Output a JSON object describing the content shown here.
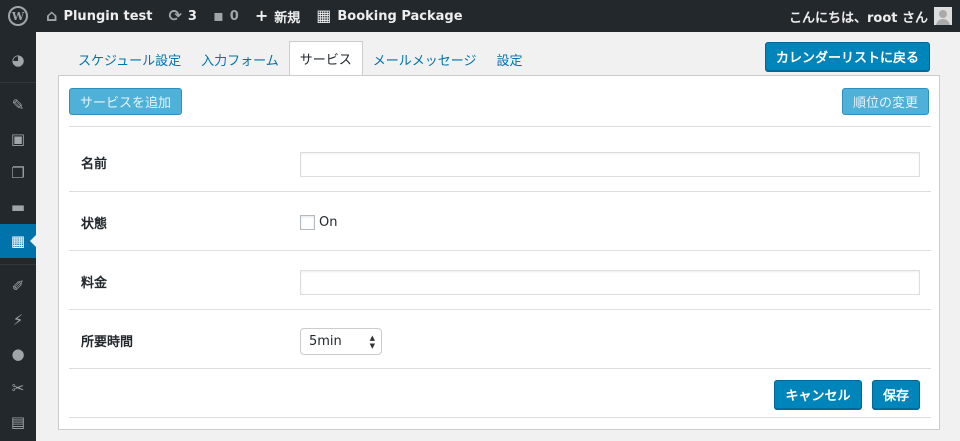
{
  "adminbar": {
    "site_name": "Plungin test",
    "updates_count": "3",
    "comments_count": "0",
    "new_label": "新規",
    "plugin_name": "Booking Package",
    "greeting": "こんにちは、root さん"
  },
  "tabs": [
    "スケジュール設定",
    "入力フォーム",
    "サービス",
    "メールメッセージ",
    "設定"
  ],
  "active_tab": "サービス",
  "buttons": {
    "back_to_calendar": "カレンダーリストに戻る",
    "add_service": "サービスを追加",
    "change_order": "順位の変更",
    "cancel": "キャンセル",
    "save": "保存"
  },
  "form": {
    "name_label": "名前",
    "name_value": "",
    "status_label": "状態",
    "status_option": "On",
    "status_checked": false,
    "price_label": "料金",
    "price_value": "",
    "duration_label": "所要時間",
    "duration_value": "5min"
  },
  "colors": {
    "adminbar_bg": "#23282d",
    "accent": "#0073aa",
    "primary_button": "#0085ba"
  },
  "icons": {
    "sidebar": [
      "dashboard-icon",
      "pin-icon",
      "media-icon",
      "pages-icon",
      "comments-icon",
      "calendar-icon",
      "appearance-icon",
      "plugins-icon",
      "users-icon",
      "tools-icon",
      "settings-icon"
    ]
  }
}
